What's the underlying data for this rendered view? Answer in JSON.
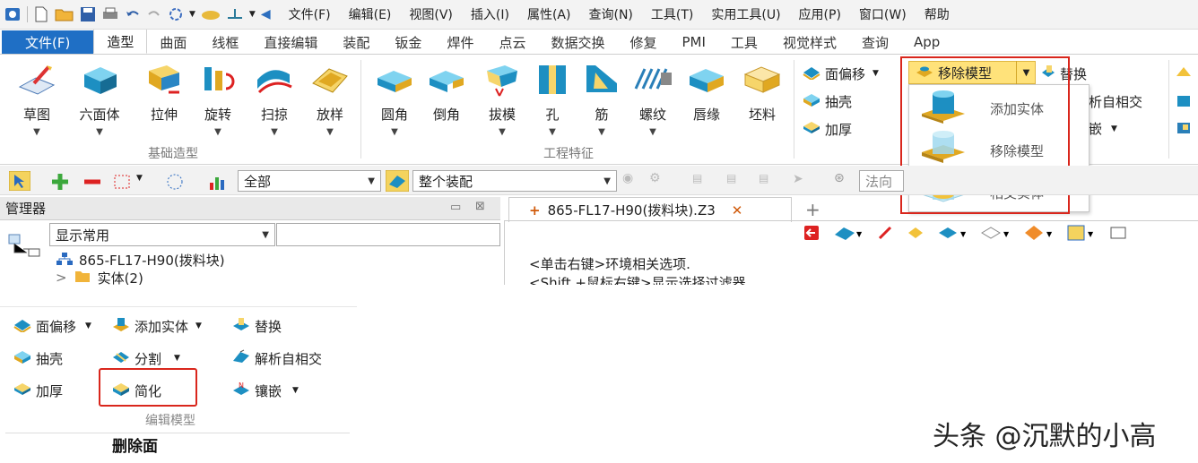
{
  "quick_menu": [
    "文件(F)",
    "编辑(E)",
    "视图(V)",
    "插入(I)",
    "属性(A)",
    "查询(N)",
    "工具(T)",
    "实用工具(U)",
    "应用(P)",
    "窗口(W)",
    "帮助"
  ],
  "ribbon_tabs": [
    "文件(F)",
    "造型",
    "曲面",
    "线框",
    "直接编辑",
    "装配",
    "钣金",
    "焊件",
    "点云",
    "数据交换",
    "修复",
    "PMI",
    "工具",
    "视觉样式",
    "查询",
    "App"
  ],
  "active_tab": "造型",
  "basic_group": {
    "label": "基础造型",
    "buttons": [
      "草图",
      "六面体",
      "拉伸",
      "旋转",
      "扫掠",
      "放样"
    ]
  },
  "eng_group": {
    "label": "工程特征",
    "buttons": [
      "圆角",
      "倒角",
      "拔模",
      "孔",
      "筋",
      "螺纹",
      "唇缘",
      "坯料"
    ]
  },
  "edit_group": {
    "face_offset": "面偏移",
    "shell": "抽壳",
    "thicken": "加厚",
    "remove_model": "移除模型",
    "replace": "替换",
    "self_intersect_partial": "析自相交",
    "inlay_partial": "嵌"
  },
  "popup": {
    "items": [
      "添加实体",
      "移除模型",
      "相交实体"
    ]
  },
  "filter_bar": {
    "filter_value": "全部",
    "assembly_value": "整个装配",
    "normal_label": "法向"
  },
  "manager": {
    "title": "管理器",
    "display_value": "显示常用",
    "tree_root": "865-FL17-H90(拨料块)",
    "tree_child": "实体(2)"
  },
  "document": {
    "tab_title": "865-FL17-H90(拨料块).Z3",
    "hint1": "<单击右键>环境相关选项.",
    "hint2": "<Shift +鼠标右键>显示选择过滤器"
  },
  "crop_panel": {
    "face_offset": "面偏移",
    "add_solid": "添加实体",
    "replace": "替换",
    "shell": "抽壳",
    "split": "分割",
    "resolve_self_intersect": "解析自相交",
    "thicken": "加厚",
    "simplify": "简化",
    "inlay": "镶嵌",
    "group_label": "编辑模型"
  },
  "caption": "删除面",
  "watermark": "头条 @沉默的小高",
  "colors": {
    "file_tab": "#1f6fc5",
    "highlight": "#ffe27a",
    "red_box": "#d9261c"
  }
}
